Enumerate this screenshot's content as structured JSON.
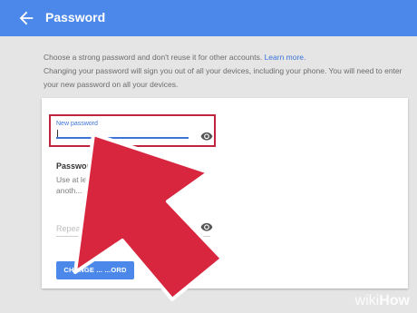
{
  "header": {
    "title": "Password",
    "back_icon": "arrow-left-icon"
  },
  "intro": {
    "line1": "Choose a strong password and don't reuse it for other accounts.",
    "link": "Learn more.",
    "line2": "Changing your password will sign you out of all your devices, including your phone. You will need to enter your new password on all your devices."
  },
  "form": {
    "new_password_label": "New password",
    "eye_icon": "eye-icon",
    "strength_label": "Password",
    "strength_hint": "Use at lea... Don't use a password from anoth... ...g too obvious like your p...",
    "repeat_placeholder": "Repeat n...",
    "change_button": "CHANGE ... ...ORD"
  },
  "overlay": {
    "arrow_color": "#d9263f",
    "watermark_part1": "wiki",
    "watermark_part2": "How"
  },
  "colors": {
    "accent": "#4b88ea",
    "highlight_border": "#c0233e"
  }
}
